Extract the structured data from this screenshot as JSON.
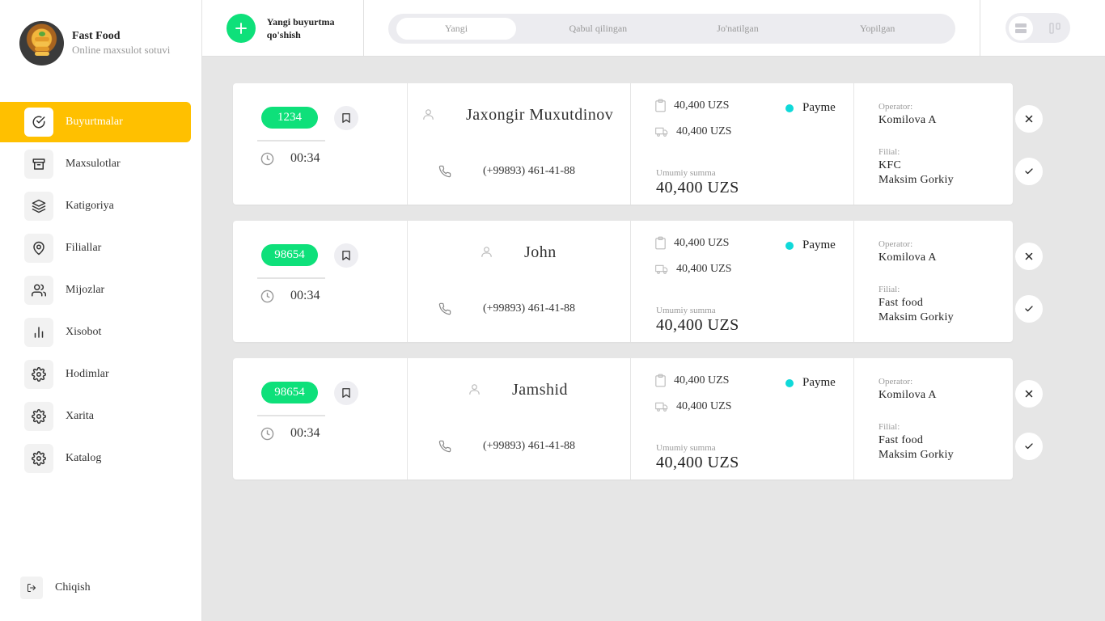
{
  "brand": {
    "title": "Fast Food",
    "subtitle": "Online maxsulot sotuvi"
  },
  "sidebar": {
    "items": [
      {
        "label": "Buyurtmalar",
        "icon": "check-circle-icon",
        "active": true
      },
      {
        "label": "Maxsulotlar",
        "icon": "archive-icon"
      },
      {
        "label": "Katigoriya",
        "icon": "layers-icon"
      },
      {
        "label": "Filiallar",
        "icon": "map-pin-icon"
      },
      {
        "label": "Mijozlar",
        "icon": "users-icon"
      },
      {
        "label": "Xisobot",
        "icon": "bar-chart-icon"
      },
      {
        "label": "Hodimlar",
        "icon": "gear-icon"
      },
      {
        "label": "Xarita",
        "icon": "gear-icon"
      },
      {
        "label": "Katalog",
        "icon": "gear-icon"
      }
    ],
    "logout_label": "Chiqish"
  },
  "header": {
    "new_order_label": "Yangi buyurtma qo'shish",
    "tabs": [
      {
        "label": "Yangi",
        "active": true
      },
      {
        "label": "Qabul qilingan"
      },
      {
        "label": "Jo'natilgan"
      },
      {
        "label": "Yopilgan"
      }
    ]
  },
  "labels": {
    "total": "Umumiy summa",
    "operator": "Operator:",
    "branch": "Filial:"
  },
  "orders": [
    {
      "id": "1234",
      "time": "00:34",
      "customer": "Jaxongir Muxutdinov",
      "phone": "(+99893) 461-41-88",
      "products_amount": "40,400 UZS",
      "delivery_amount": "40,400 UZS",
      "payment": "Payme",
      "total": "40,400 UZS",
      "operator": "Komilova A",
      "branch_name": "KFC",
      "branch_address": "Maksim Gorkiy"
    },
    {
      "id": "98654",
      "time": "00:34",
      "customer": "John",
      "phone": "(+99893) 461-41-88",
      "products_amount": "40,400 UZS",
      "delivery_amount": "40,400 UZS",
      "payment": "Payme",
      "total": "40,400 UZS",
      "operator": "Komilova A",
      "branch_name": "Fast food",
      "branch_address": "Maksim Gorkiy"
    },
    {
      "id": "98654",
      "time": "00:34",
      "customer": "Jamshid",
      "phone": "(+99893) 461-41-88",
      "products_amount": "40,400 UZS",
      "delivery_amount": "40,400 UZS",
      "payment": "Payme",
      "total": "40,400 UZS",
      "operator": "Komilova A",
      "branch_name": "Fast food",
      "branch_address": "Maksim Gorkiy"
    }
  ],
  "colors": {
    "accent": "#ffc000",
    "success": "#0ee07a",
    "payment_dot": "#0fd9d9",
    "background": "#e6e6e6"
  }
}
